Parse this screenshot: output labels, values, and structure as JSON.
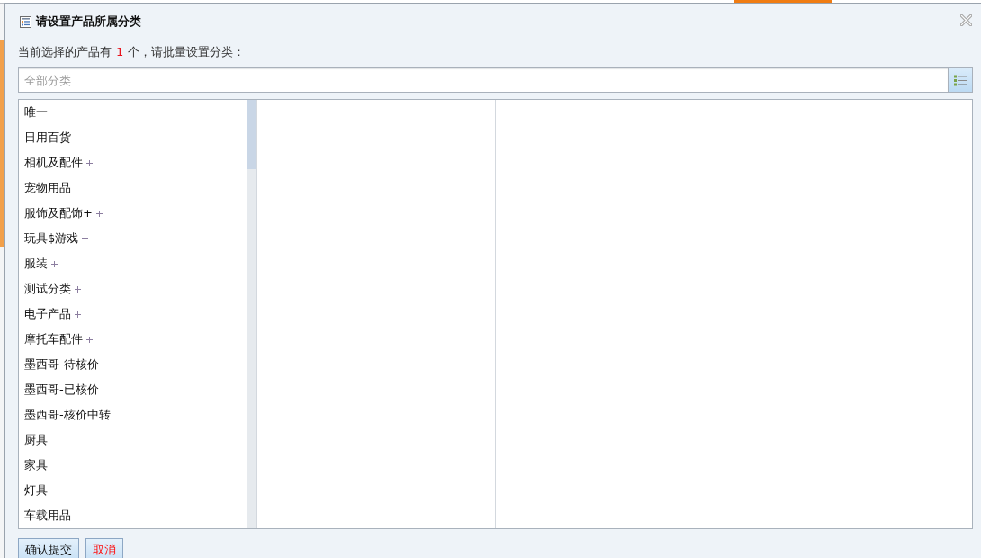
{
  "dialog": {
    "title": "请设置产品所属分类",
    "prompt": {
      "before": "当前选择的产品有",
      "count": "1",
      "after": "个，请批量设置分类："
    },
    "search": {
      "placeholder": "全部分类"
    },
    "categories": [
      {
        "label": "唯一",
        "expandable": false,
        "selected": false
      },
      {
        "label": "日用百货",
        "expandable": false,
        "selected": false
      },
      {
        "label": "相机及配件",
        "expandable": true,
        "selected": false
      },
      {
        "label": "宠物用品",
        "expandable": false,
        "selected": false
      },
      {
        "label": "服饰及配饰+",
        "expandable": true,
        "selected": false
      },
      {
        "label": "玩具$游戏",
        "expandable": true,
        "selected": false
      },
      {
        "label": "服装",
        "expandable": true,
        "selected": false
      },
      {
        "label": "测试分类",
        "expandable": true,
        "selected": false
      },
      {
        "label": "电子产品",
        "expandable": true,
        "selected": false
      },
      {
        "label": "摩托车配件",
        "expandable": true,
        "selected": false
      },
      {
        "label": "墨西哥-待核价",
        "expandable": false,
        "selected": false
      },
      {
        "label": "墨西哥-已核价",
        "expandable": false,
        "selected": false
      },
      {
        "label": "墨西哥-核价中转",
        "expandable": false,
        "selected": false
      },
      {
        "label": "厨具",
        "expandable": false,
        "selected": false
      },
      {
        "label": "家具",
        "expandable": false,
        "selected": false
      },
      {
        "label": "灯具",
        "expandable": false,
        "selected": false
      },
      {
        "label": "车载用品",
        "expandable": false,
        "selected": false
      }
    ],
    "buttons": [
      {
        "label": "确认提交",
        "kind": "submit"
      },
      {
        "label": "取消",
        "kind": "cancel"
      }
    ]
  }
}
